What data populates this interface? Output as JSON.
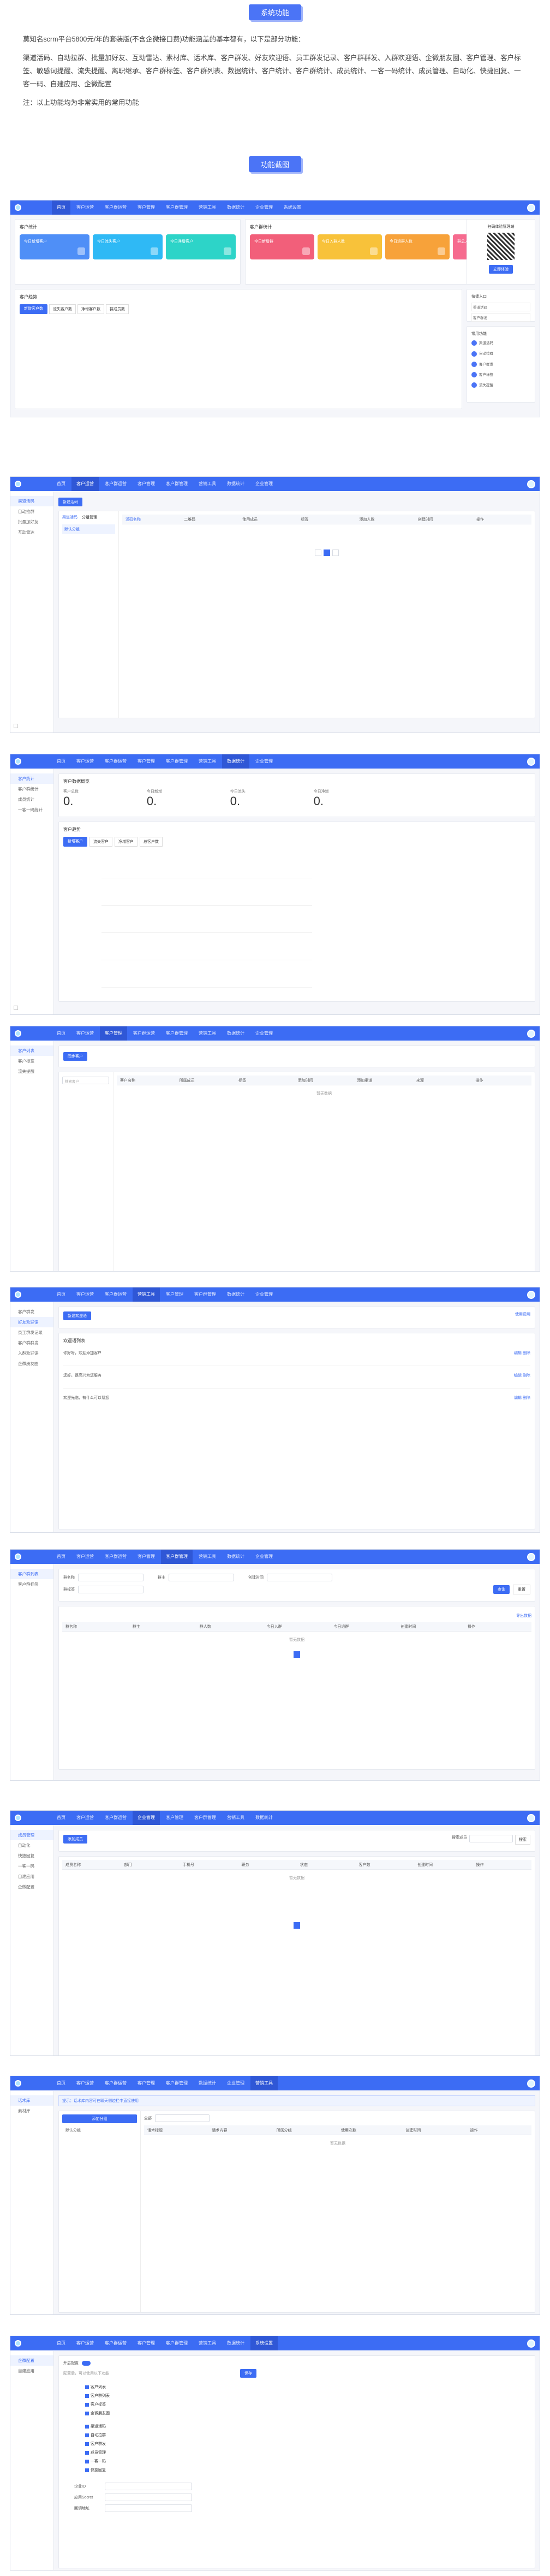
{
  "section1": {
    "title": "系统功能"
  },
  "intro": {
    "p1": "莫知名scrm平台5800元/年的套装版(不含企微接口费)功能涵盖的基本都有，以下是部分功能：",
    "p2": "渠道活码、自动拉群、批量加好友、互动雷达、素材库、话术库、客户群发、好友欢迎语、员工群发记录、客户群群发、入群欢迎语、企微朋友圈、客户管理、客户标签、敏感词提醒、流失提醒、离职继承、客户群标签、客户群列表、数据统计、客户统计、客户群统计、成员统计、一客一码统计、成员管理、自动化、快捷回复、一客一码、自建应用、企微配置",
    "p3": "注：以上功能均为非常实用的常用功能"
  },
  "section2": {
    "title": "功能截图"
  },
  "nav": [
    "首页",
    "客户运营",
    "客户群运营",
    "客户管理",
    "客户群管理",
    "营销工具",
    "数据统计",
    "企业管理",
    "系统设置"
  ],
  "shot1": {
    "left_title": "客户统计",
    "right_title": "客户群统计",
    "stats": [
      {
        "label": "今日新增客户",
        "color": "#4f8ff7"
      },
      {
        "label": "今日流失客户",
        "color": "#2fb9f5"
      },
      {
        "label": "今日净增客户",
        "color": "#2dd4c8"
      },
      {
        "label": "今日新增群",
        "color": "#f25f7a"
      },
      {
        "label": "今日入群人数",
        "color": "#f8c23a"
      },
      {
        "label": "今日退群人数",
        "color": "#f7a23a"
      },
      {
        "label": "群总人数",
        "color": "#f66b8f"
      }
    ],
    "trend_title": "客户趋势",
    "tabs": [
      "新增客户数",
      "流失客户数",
      "净增客户数",
      "群成员数"
    ],
    "qr_title": "扫码体验管理端",
    "qr_btn": "立即体验",
    "quick_title": "快捷入口",
    "quick_items": [
      "渠道活码",
      "客户群发"
    ],
    "common_title": "常用功能",
    "common_items": [
      "渠道活码",
      "自动拉群",
      "客户群发",
      "客户标签",
      "流失提醒"
    ]
  },
  "shot2": {
    "side": [
      "渠道活码",
      "自动拉群",
      "批量加好友",
      "互动雷达"
    ],
    "btn": "新建活码",
    "tabs": [
      "渠道活码",
      "分组管理"
    ],
    "group": "默认分组",
    "cols": [
      "活码名称",
      "二维码",
      "使用成员",
      "标签",
      "添加人数",
      "创建时间",
      "操作"
    ]
  },
  "shot3": {
    "side": [
      "客户统计",
      "客户群统计",
      "成员统计",
      "一客一码统计"
    ],
    "title": "客户数据概览",
    "kpis": [
      {
        "label": "客户总数",
        "value": "0."
      },
      {
        "label": "今日新增",
        "value": "0."
      },
      {
        "label": "今日流失",
        "value": "0."
      },
      {
        "label": "今日净增",
        "value": "0."
      }
    ],
    "trend": "客户趋势",
    "tabs": [
      "新增客户",
      "流失客户",
      "净增客户",
      "总客户数"
    ]
  },
  "shot4": {
    "side": [
      "客户列表",
      "客户标签",
      "流失提醒"
    ],
    "btn": "同步客户",
    "search": "搜索客户",
    "cols": [
      "客户名称",
      "所属成员",
      "标签",
      "添加时间",
      "添加渠道",
      "来源",
      "操作"
    ],
    "empty": "暂无数据"
  },
  "shot5": {
    "side": [
      "客户群发",
      "好友欢迎语",
      "员工群发记录",
      "客户群群发",
      "入群欢迎语",
      "企微朋友圈"
    ],
    "btn": "新建欢迎语",
    "right_link": "使用说明",
    "list_title": "欢迎语列表",
    "items": [
      {
        "text": "你好呀，欢迎添加客户",
        "op": "编辑 删除"
      },
      {
        "text": "您好，很高兴为您服务",
        "op": "编辑 删除"
      },
      {
        "text": "欢迎光临，有什么可以帮您",
        "op": "编辑 删除"
      }
    ]
  },
  "shot6": {
    "side": [
      "客户群列表",
      "客户群标签"
    ],
    "fields": [
      "群名称",
      "群主",
      "创建时间",
      "群标签"
    ],
    "search_btn": "查询",
    "reset_btn": "重置",
    "cols": [
      "群名称",
      "群主",
      "群人数",
      "今日入群",
      "今日退群",
      "创建时间",
      "操作"
    ],
    "empty": "暂无数据",
    "export": "导出数据"
  },
  "shot7": {
    "side": [
      "成员管理",
      "自动化",
      "快捷回复",
      "一客一码",
      "自建应用",
      "企微配置"
    ],
    "btn": "添加成员",
    "search_label": "搜索成员",
    "search_btn": "搜索",
    "cols": [
      "成员名称",
      "部门",
      "手机号",
      "职务",
      "状态",
      "客户数",
      "创建时间",
      "操作"
    ],
    "empty": "暂无数据"
  },
  "shot8": {
    "side": [
      "话术库",
      "素材库"
    ],
    "tip": "提示：话术库内容可在聊天侧边栏中直接使用",
    "btn": "添加分组",
    "group": "默认分组",
    "select": "全部",
    "cols": [
      "话术标题",
      "话术内容",
      "所属分组",
      "使用次数",
      "创建时间",
      "操作"
    ],
    "empty": "暂无数据"
  },
  "shot9": {
    "side": [
      "企微配置",
      "自建应用"
    ],
    "switch_label": "开启配置",
    "note": "配置后，可以使用以下功能",
    "save_btn": "保存",
    "items": [
      "客户列表",
      "客户群列表",
      "客户标签",
      "企微朋友圈",
      "渠道活码",
      "自动拉群",
      "客户群发",
      "成员管理",
      "一客一码",
      "快捷回复"
    ],
    "bottom_fields": [
      "企业ID",
      "应用Secret",
      "回调地址"
    ]
  }
}
